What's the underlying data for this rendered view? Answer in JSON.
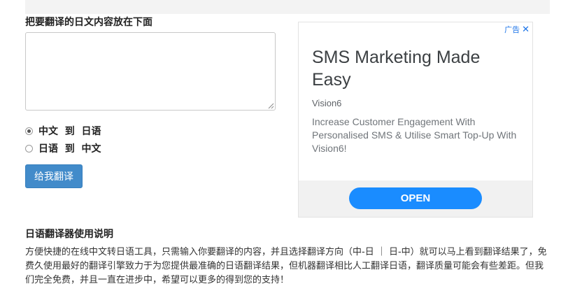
{
  "form": {
    "input_heading": "把要翻译的日文内容放在下面",
    "source_text_value": "",
    "directions": [
      {
        "label": "中文  到  日语",
        "checked": true
      },
      {
        "label": "日语  到  中文",
        "checked": false
      }
    ],
    "submit_label": "给我翻译"
  },
  "ad": {
    "choices_label": "广告",
    "close_glyph": "✕",
    "headline": "SMS Marketing Made Easy",
    "advertiser": "Vision6",
    "body": "Increase Customer Engagement With Personalised SMS & Utilise Smart Top-Up With Vision6!",
    "cta_label": "OPEN",
    "cta_color": "#1a8cff"
  },
  "instructions": {
    "heading": "日语翻译器使用说明",
    "paragraph": "方便快捷的在线中文转日语工具，只需输入你要翻译的内容，并且选择翻译方向（中-日 ｜ 日-中）就可以马上看到翻译结果了，免费久使用最好的翻译引擎致力于为您提供最准确的日语翻译结果，但机器翻译相比人工翻译日语，翻译质量可能会有些差距。但我们完全免费，并且一直在进步中，希望可以更多的得到您的支持！"
  },
  "colors": {
    "button_primary": "#428bca",
    "ad_cta": "#1a8cff"
  }
}
